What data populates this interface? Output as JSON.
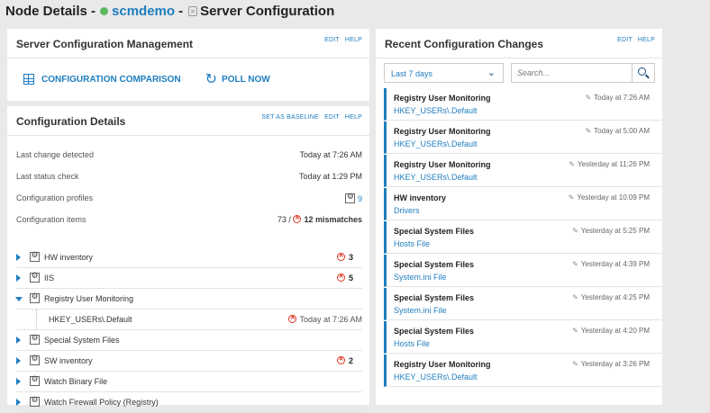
{
  "header": {
    "prefix": "Node Details -",
    "node": "scmdemo",
    "sep": "-",
    "section": "Server Configuration"
  },
  "management": {
    "title": "Server Configuration Management",
    "edit": "EDIT",
    "help": "HELP",
    "compare_label": "CONFIGURATION COMPARISON",
    "poll_label": "POLL NOW"
  },
  "details": {
    "title": "Configuration Details",
    "baseline": "SET AS BASELINE",
    "edit": "EDIT",
    "help": "HELP",
    "last_change_label": "Last change detected",
    "last_change_value": "Today at 7:26 AM",
    "last_status_label": "Last status check",
    "last_status_value": "Today at 1:29 PM",
    "profiles_label": "Configuration profiles",
    "profiles_value": "9",
    "items_label": "Configuration items",
    "items_total": "73 /",
    "items_mismatches": "12 mismatches",
    "tree": [
      {
        "label": "HW inventory",
        "count": "3"
      },
      {
        "label": "IIS",
        "count": "5"
      },
      {
        "label": "Registry User Monitoring",
        "count": ""
      },
      {
        "label": "HKEY_USERs\\.Default",
        "time": "Today at 7:26 AM"
      },
      {
        "label": "Special System Files",
        "count": ""
      },
      {
        "label": "SW inventory",
        "count": "2"
      },
      {
        "label": "Watch Binary File",
        "count": ""
      },
      {
        "label": "Watch Firewall Policy (Registry)",
        "count": ""
      }
    ]
  },
  "recent": {
    "title": "Recent Configuration Changes",
    "edit": "EDIT",
    "help": "HELP",
    "range": "Last 7 days",
    "search_placeholder": "Search...",
    "changes": [
      {
        "title": "Registry User Monitoring",
        "item": "HKEY_USERs\\.Default",
        "when": "Today at 7:26 AM"
      },
      {
        "title": "Registry User Monitoring",
        "item": "HKEY_USERs\\.Default",
        "when": "Today at 5:00 AM"
      },
      {
        "title": "Registry User Monitoring",
        "item": "HKEY_USERs\\.Default",
        "when": "Yesterday at 11:26 PM"
      },
      {
        "title": "HW inventory",
        "item": "Drivers",
        "when": "Yesterday at 10:09 PM"
      },
      {
        "title": "Special System Files",
        "item": "Hosts File",
        "when": "Yesterday at 5:25 PM"
      },
      {
        "title": "Special System Files",
        "item": "System.ini File",
        "when": "Yesterday at 4:39 PM"
      },
      {
        "title": "Special System Files",
        "item": "System.ini File",
        "when": "Yesterday at 4:25 PM"
      },
      {
        "title": "Special System Files",
        "item": "Hosts File",
        "when": "Yesterday at 4:20 PM"
      },
      {
        "title": "Registry User Monitoring",
        "item": "HKEY_USERs\\.Default",
        "when": "Yesterday at 3:26 PM"
      }
    ]
  },
  "colors": {
    "accent": "#1f7dbf",
    "status_ok": "#5cb85c",
    "mismatch": "#dd3322"
  }
}
